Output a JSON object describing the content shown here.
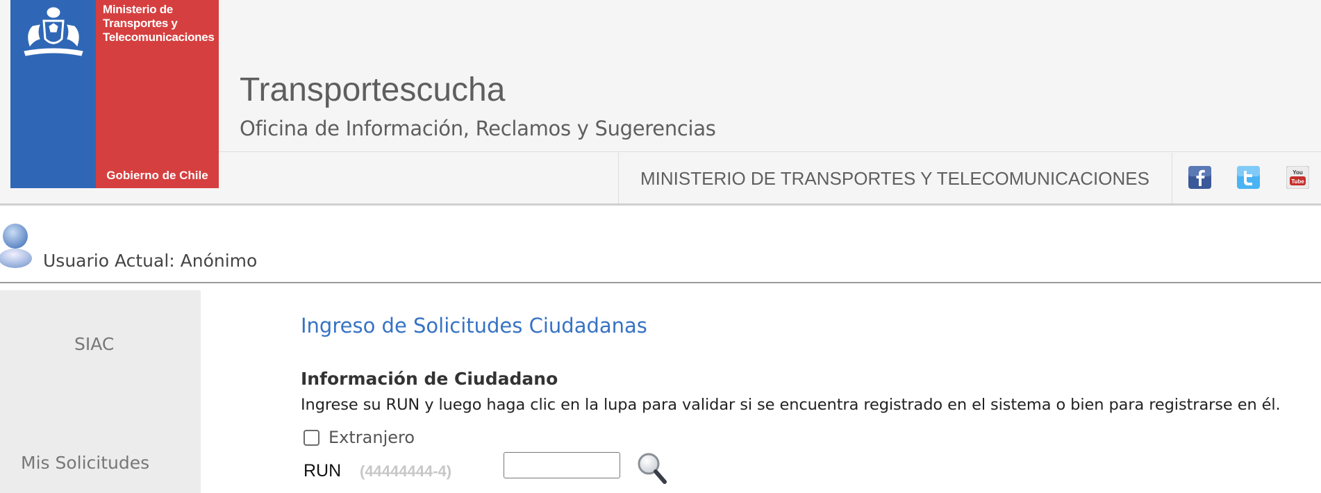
{
  "header": {
    "logo": {
      "ministry_text": [
        "Ministerio de",
        "Transportes y",
        "Telecomunicaciones"
      ],
      "government_text": "Gobierno de Chile",
      "colors": {
        "blue": "#2f67b6",
        "red": "#d63f3f"
      }
    },
    "site_title": "Transportescucha",
    "site_subtitle": "Oficina de Información, Reclamos y Sugerencias",
    "ministry_link": "MINISTERIO DE TRANSPORTES Y TELECOMUNICACIONES",
    "social": [
      {
        "icon": "facebook-icon",
        "color": "#3b5998"
      },
      {
        "icon": "twitter-icon",
        "color": "#4ab3f4"
      },
      {
        "icon": "youtube-icon",
        "color": "#c4302b"
      }
    ]
  },
  "user": {
    "label": "Usuario Actual: Anónimo",
    "icon": "user-avatar-icon"
  },
  "sidebar": {
    "items": [
      {
        "label": "SIAC"
      },
      {
        "label": "Mis Solicitudes"
      }
    ]
  },
  "main": {
    "heading": "Ingreso de Solicitudes Ciudadanas",
    "section_title": "Información de Ciudadano",
    "instructions": "Ingrese su RUN y luego haga clic en la lupa para validar si se encuentra registrado en el sistema o bien para registrarse en él.",
    "foreign": {
      "label": "Extranjero",
      "checked": false
    },
    "run": {
      "label": "RUN",
      "hint": "(44444444-4)",
      "value": "",
      "search_icon": "magnifier-icon"
    },
    "accent_color": "#3672c4"
  }
}
